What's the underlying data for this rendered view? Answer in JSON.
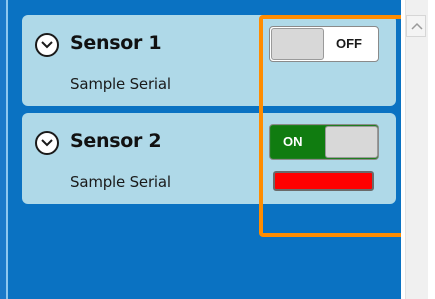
{
  "sensors": [
    {
      "name": "Sensor 1",
      "serial": "Sample Serial",
      "toggle": {
        "state": "off",
        "label": "OFF"
      },
      "expand_icon": "chevron-down-icon"
    },
    {
      "name": "Sensor 2",
      "serial": "Sample Serial",
      "toggle": {
        "state": "on",
        "label": "ON"
      },
      "status_indicator_color": "#ff0000",
      "expand_icon": "chevron-down-icon"
    }
  ],
  "colors": {
    "panel_background": "#0a72c2",
    "card_background": "#afd9e8",
    "toggle_on": "#107c10",
    "highlight": "#ff8c00",
    "status_error": "#ff0000"
  },
  "scrollbar": {
    "up_icon": "chevron-up-icon"
  }
}
